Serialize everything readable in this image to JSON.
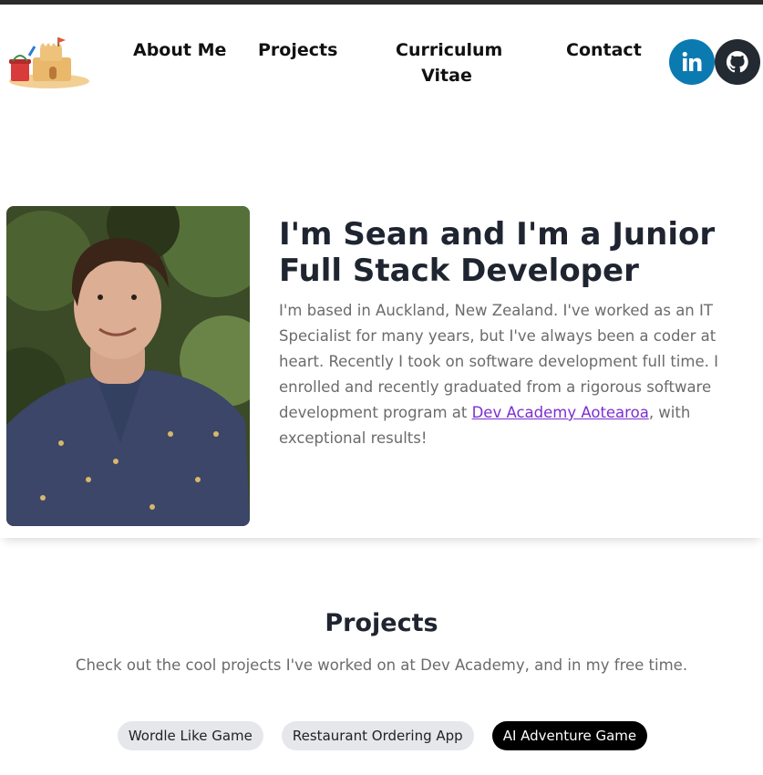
{
  "nav": {
    "links": [
      "About Me",
      "Projects",
      "Curriculum Vitae",
      "Contact"
    ],
    "social": {
      "linkedin_icon": "linkedin-icon",
      "github_icon": "github-icon",
      "linkedin_color": "#0a7ab1",
      "github_color": "#232a31"
    }
  },
  "hero": {
    "title": "I'm Sean and I'm a Junior Full Stack Developer",
    "text_before": "I'm based in Auckland, New Zealand. I've worked as an IT Specialist for many years, but I've always been a coder at heart. Recently I took on software development full time. I enrolled and recently graduated from a rigorous software development program at ",
    "link": "Dev Academy Aotearoa",
    "text_after": ", with exceptional results!"
  },
  "projects": {
    "title": "Projects",
    "subtitle": "Check out the cool projects I've worked on at Dev Academy, and in my free time.",
    "tabs": [
      "Wordle Like Game",
      "Restaurant Ordering App",
      "AI Adventure Game"
    ],
    "active_tab": "AI Adventure Game"
  }
}
